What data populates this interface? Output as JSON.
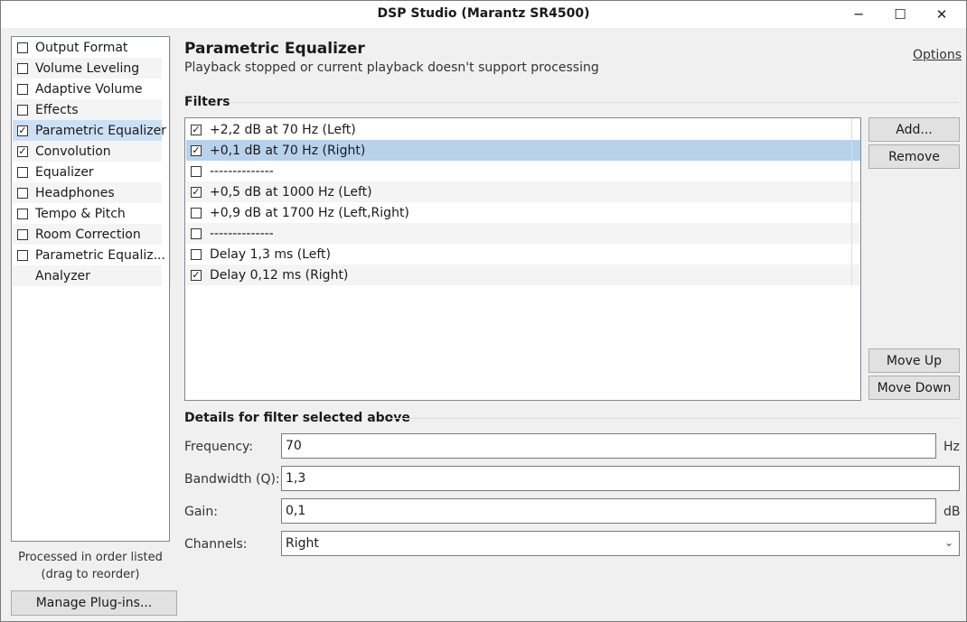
{
  "window": {
    "title": "DSP Studio (Marantz SR4500)",
    "minimize_glyph": "─",
    "maximize_glyph": "☐",
    "close_glyph": "✕"
  },
  "sidebar": {
    "items": [
      {
        "label": "Output Format",
        "checked": false,
        "has_checkbox": true
      },
      {
        "label": "Volume Leveling",
        "checked": false,
        "has_checkbox": true
      },
      {
        "label": "Adaptive Volume",
        "checked": false,
        "has_checkbox": true
      },
      {
        "label": "Effects",
        "checked": false,
        "has_checkbox": true
      },
      {
        "label": "Parametric Equalizer",
        "checked": true,
        "has_checkbox": true,
        "selected": true
      },
      {
        "label": "Convolution",
        "checked": true,
        "has_checkbox": true
      },
      {
        "label": "Equalizer",
        "checked": false,
        "has_checkbox": true
      },
      {
        "label": "Headphones",
        "checked": false,
        "has_checkbox": true
      },
      {
        "label": "Tempo & Pitch",
        "checked": false,
        "has_checkbox": true
      },
      {
        "label": "Room Correction",
        "checked": false,
        "has_checkbox": true
      },
      {
        "label": "Parametric Equaliz...",
        "checked": false,
        "has_checkbox": true
      },
      {
        "label": "Analyzer",
        "checked": false,
        "has_checkbox": false
      }
    ],
    "footer_line1": "Processed in order listed",
    "footer_line2": "(drag to reorder)",
    "manage_button": "Manage Plug-ins..."
  },
  "main": {
    "title": "Parametric Equalizer",
    "subtitle": "Playback stopped or current playback doesn't support processing",
    "options_link": "Options",
    "filters_heading": "Filters",
    "filters": [
      {
        "label": "+2,2 dB at 70 Hz (Left)",
        "checked": true
      },
      {
        "label": "+0,1 dB at 70 Hz (Right)",
        "checked": true,
        "selected": true
      },
      {
        "label": "--------------",
        "checked": false
      },
      {
        "label": "+0,5 dB at 1000 Hz (Left)",
        "checked": true
      },
      {
        "label": "+0,9 dB at 1700 Hz (Left,Right)",
        "checked": false
      },
      {
        "label": "--------------",
        "checked": false
      },
      {
        "label": "Delay 1,3 ms (Left)",
        "checked": false
      },
      {
        "label": "Delay 0,12 ms (Right)",
        "checked": true
      }
    ],
    "buttons": {
      "add": "Add...",
      "remove": "Remove",
      "move_up": "Move Up",
      "move_down": "Move Down"
    },
    "details_heading": "Details for filter selected above",
    "details": {
      "frequency_label": "Frequency:",
      "frequency_value": "70",
      "frequency_unit": "Hz",
      "bandwidth_label": "Bandwidth (Q):",
      "bandwidth_value": "1,3",
      "gain_label": "Gain:",
      "gain_value": "0,1",
      "gain_unit": "dB",
      "channels_label": "Channels:",
      "channels_value": "Right",
      "channels_chevron": "⌄"
    },
    "checkmark_glyph": "✓"
  },
  "colors": {
    "selection_left": "#cce0f5",
    "selection_filter": "#b8d2ec",
    "link_chevron": "#1a4fb0"
  }
}
